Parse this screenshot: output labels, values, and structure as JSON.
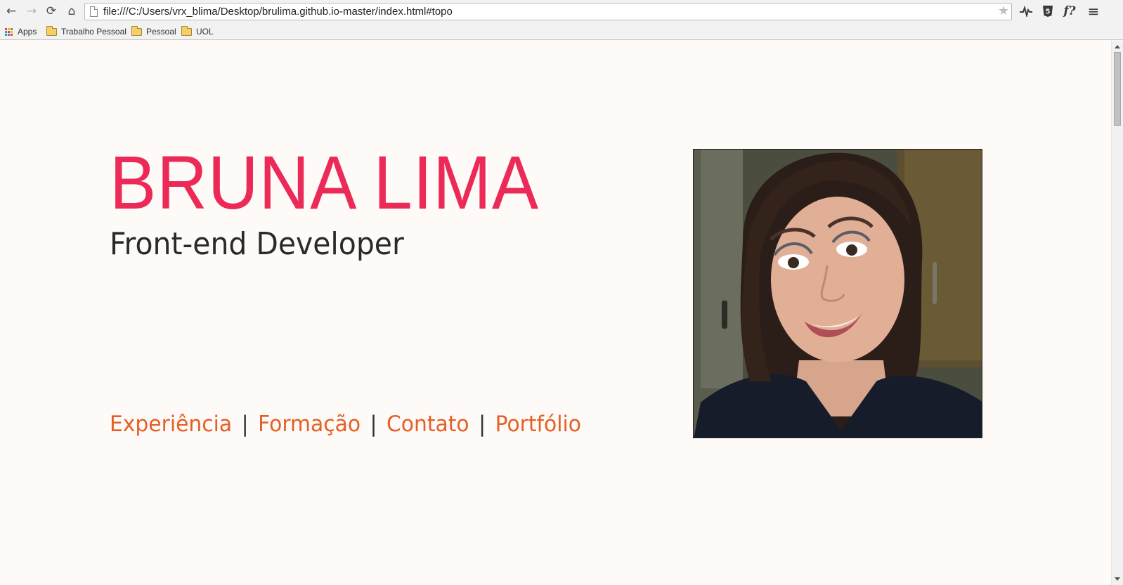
{
  "browser": {
    "url": "file:///C:/Users/vrx_blima/Desktop/brulima.github.io-master/index.html#topo",
    "nav": {
      "back": "←",
      "forward": "→",
      "reload": "⟳",
      "home": "⌂"
    },
    "star": "★",
    "extensions": {
      "pulse": "ᴧ",
      "html5": "5",
      "font": "f?",
      "menu": "≡"
    },
    "bookmarks": [
      {
        "label": "Apps"
      },
      {
        "label": "Trabalho Pessoal"
      },
      {
        "label": "Pessoal"
      },
      {
        "label": "UOL"
      }
    ]
  },
  "page": {
    "name": "BRUNA LIMA",
    "role": "Front-end Developer",
    "nav": [
      "Experiência",
      "Formação",
      "Contato",
      "Portfólio"
    ],
    "separator": "|",
    "colors": {
      "accent": "#ec2a58",
      "link": "#e65f26",
      "text": "#2a2a2a",
      "background": "#fdfaf8"
    }
  }
}
